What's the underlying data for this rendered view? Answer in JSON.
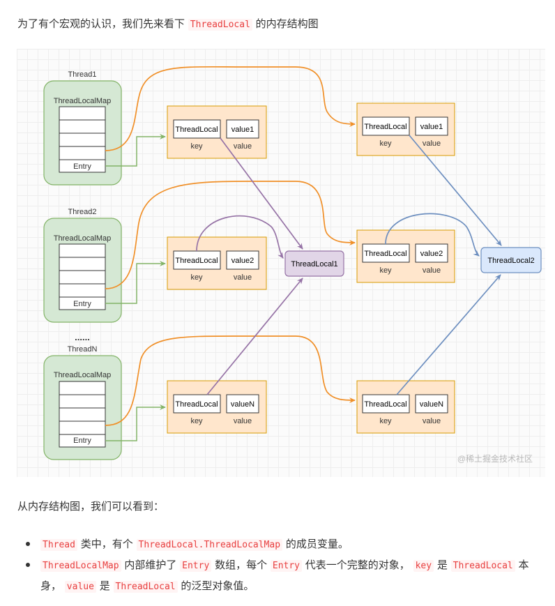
{
  "intro": {
    "before": "为了有个宏观的认识，我们先来看下",
    "code": "ThreadLocal",
    "after": "的内存结构图"
  },
  "diagram": {
    "threads": [
      {
        "name": "Thread1",
        "map_label": "ThreadLocalMap",
        "entry_label": "Entry"
      },
      {
        "name": "Thread2",
        "map_label": "ThreadLocalMap",
        "entry_label": "Entry"
      },
      {
        "name": "ThreadN",
        "map_label": "ThreadLocalMap",
        "entry_label": "Entry"
      }
    ],
    "ellipsis": "......",
    "left_entries": [
      {
        "key": "ThreadLocal",
        "value": "value1",
        "key_caption": "key",
        "value_caption": "value"
      },
      {
        "key": "ThreadLocal",
        "value": "value2",
        "key_caption": "key",
        "value_caption": "value"
      },
      {
        "key": "ThreadLocal",
        "value": "valueN",
        "key_caption": "key",
        "value_caption": "value"
      }
    ],
    "right_entries": [
      {
        "key": "ThreadLocal",
        "value": "value1",
        "key_caption": "key",
        "value_caption": "value"
      },
      {
        "key": "ThreadLocal",
        "value": "value2",
        "key_caption": "key",
        "value_caption": "value"
      },
      {
        "key": "ThreadLocal",
        "value": "valueN",
        "key_caption": "key",
        "value_caption": "value"
      }
    ],
    "threadlocal1": "ThreadLocal1",
    "threadlocal2": "ThreadLocal2",
    "watermark": "@稀土掘金技术社区",
    "colors": {
      "thread_fill": "#d5e8d4",
      "thread_stroke": "#82b366",
      "entry_fill": "#ffe6cc",
      "entry_stroke": "#d79b00",
      "tl1_fill": "#e1d5e7",
      "tl1_stroke": "#9673a6",
      "tl2_fill": "#dae8fc",
      "tl2_stroke": "#6c8ebf",
      "orange_arrow": "#f08f27",
      "green_arrow": "#82b366",
      "purple_arrow": "#9673a6",
      "blue_arrow": "#6c8ebf"
    }
  },
  "outro": "从内存结构图，我们可以看到：",
  "bullets": [
    {
      "c1": "Thread",
      "t1": "类中，有个",
      "c2": "ThreadLocal.ThreadLocalMap",
      "t2": "的成员变量。"
    },
    {
      "c1": "ThreadLocalMap",
      "t1": "内部维护了",
      "c2": "Entry",
      "t2": "数组，每个",
      "c3": "Entry",
      "t3": "代表一个完整的对象，",
      "c4": "key",
      "t4": "是",
      "c5": "ThreadLocal",
      "t5": "本",
      "t6": "身，",
      "c6": "value",
      "t7": "是",
      "c7": "ThreadLocal",
      "t8": "的泛型对象值。"
    }
  ]
}
